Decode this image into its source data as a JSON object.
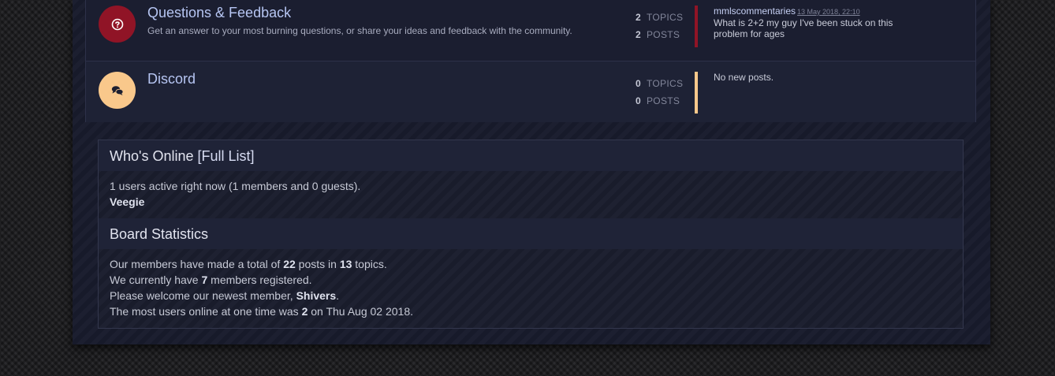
{
  "forums": [
    {
      "title": "Questions & Feedback",
      "description": "Get an answer to your most burning questions, or share your ideas and feedback with the community.",
      "icon": "question-circle-icon",
      "accent": "#901426",
      "topics": "2",
      "posts": "2",
      "topics_label": "TOPICS",
      "posts_label": "POSTS",
      "last_post_user": "mmlscommentaries",
      "last_post_date": "13 May 2018, 22:10",
      "last_post_title": "What is 2+2 my guy I've been stuck on this problem for ages"
    },
    {
      "title": "Discord",
      "description": "",
      "icon": "chat-bubbles-icon",
      "accent": "#f9c88b",
      "topics": "0",
      "posts": "0",
      "topics_label": "TOPICS",
      "posts_label": "POSTS",
      "no_posts": "No new posts."
    }
  ],
  "whos_online": {
    "title": "Who's Online",
    "full_list_link": "[Full List]",
    "summary": "1 users active right now (1 members and 0 guests).",
    "members": [
      "Veegie"
    ]
  },
  "board_stats": {
    "title": "Board Statistics",
    "line1_pre": "Our members have made a total of ",
    "posts": "22",
    "line1_mid": " posts in ",
    "topics": "13",
    "line1_post": " topics.",
    "line2_pre": "We currently have ",
    "members": "7",
    "line2_post": " members registered.",
    "line3_pre": "Please welcome our newest member, ",
    "newest_member": "Shivers",
    "line3_post": ".",
    "line4_pre": "The most users online at one time was ",
    "most_online": "2",
    "line4_post": " on Thu Aug 02 2018."
  }
}
